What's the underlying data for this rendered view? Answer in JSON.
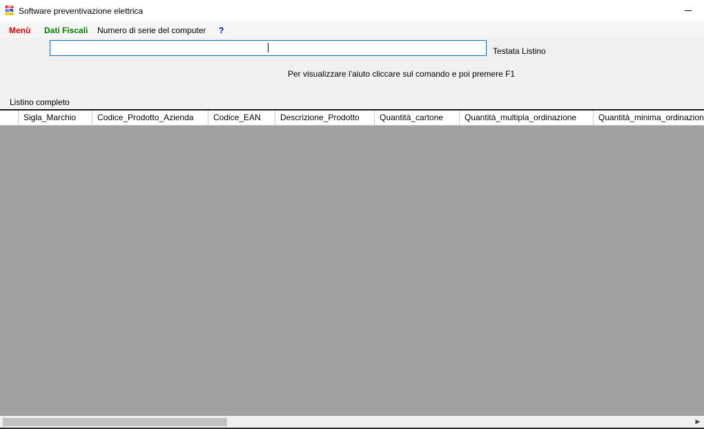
{
  "window": {
    "title": "Software preventivazione elettrica",
    "icon": "app-logo-icon",
    "minimize_icon": "minimize-icon"
  },
  "menu": [
    {
      "label": "Menù",
      "color": "#e00000",
      "bold": true
    },
    {
      "label": "Dati Fiscali",
      "color": "#008000",
      "bold": true
    },
    {
      "label": "Numero di serie del computer",
      "color": "#000000",
      "bold": false
    },
    {
      "label": "?",
      "color": "#0000c0",
      "bold": true
    }
  ],
  "header": {
    "input_value": "",
    "label": "Testata Listino"
  },
  "help_text": "Per visualizzare l'aiuto cliccare sul comando e poi premere F1",
  "list_label": "Listino completo",
  "grid": {
    "columns": [
      "Sigla_Marchio",
      "Codice_Prodotto_Azienda",
      "Codice_EAN",
      "Descrizione_Prodotto",
      "Quantità_cartone",
      "Quantità_multipla_ordinazione",
      "Quantità_minima_ordinazione"
    ],
    "rows": []
  },
  "scrollbar": {
    "right_arrow": "▶"
  }
}
